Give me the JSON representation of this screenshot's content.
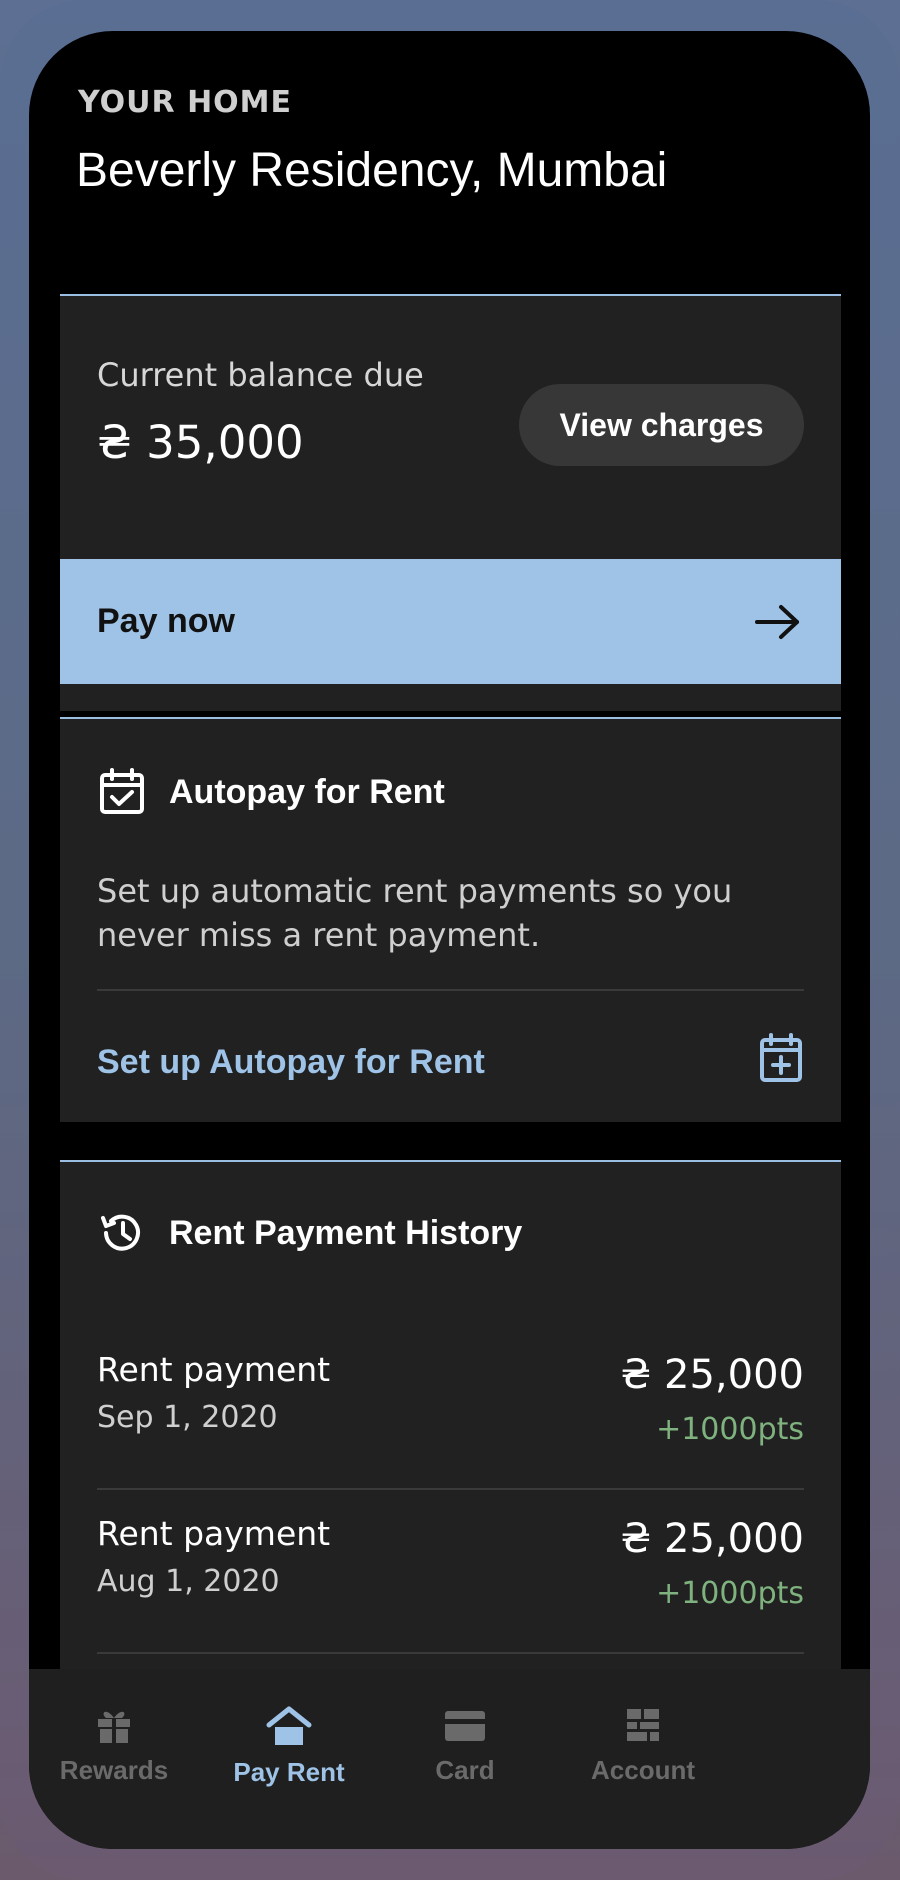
{
  "header": {
    "eyebrow": "YOUR HOME",
    "title": "Beverly Residency, Mumbai"
  },
  "balance": {
    "label": "Current balance due",
    "amount": "₴ 35,000",
    "view_charges_label": "View charges",
    "pay_now_label": "Pay now",
    "pay_icon": "arrow-right-icon"
  },
  "autopay": {
    "icon": "calendar-check-icon",
    "title": "Autopay for Rent",
    "description": "Set up automatic rent payments so you never miss a rent payment.",
    "link_label": "Set up Autopay for Rent",
    "link_icon": "calendar-add-icon"
  },
  "history": {
    "icon": "history-icon",
    "title": "Rent Payment History",
    "rows": [
      {
        "title": "Rent payment",
        "date": "Sep 1, 2020",
        "amount": "₴ 25,000",
        "points": "+1000pts"
      },
      {
        "title": "Rent payment",
        "date": "Aug 1, 2020",
        "amount": "₴ 25,000",
        "points": "+1000pts"
      }
    ]
  },
  "tabs": [
    {
      "label": "Rewards",
      "icon": "gift-icon",
      "active": false
    },
    {
      "label": "Pay Rent",
      "icon": "home-icon",
      "active": true
    },
    {
      "label": "Card",
      "icon": "card-icon",
      "active": false
    },
    {
      "label": "Account",
      "icon": "account-icon",
      "active": false
    }
  ],
  "colors": {
    "accent": "#9ec3e7",
    "points_green": "#7fb27f",
    "card_bg": "#212121",
    "screen_bg": "#000000"
  }
}
